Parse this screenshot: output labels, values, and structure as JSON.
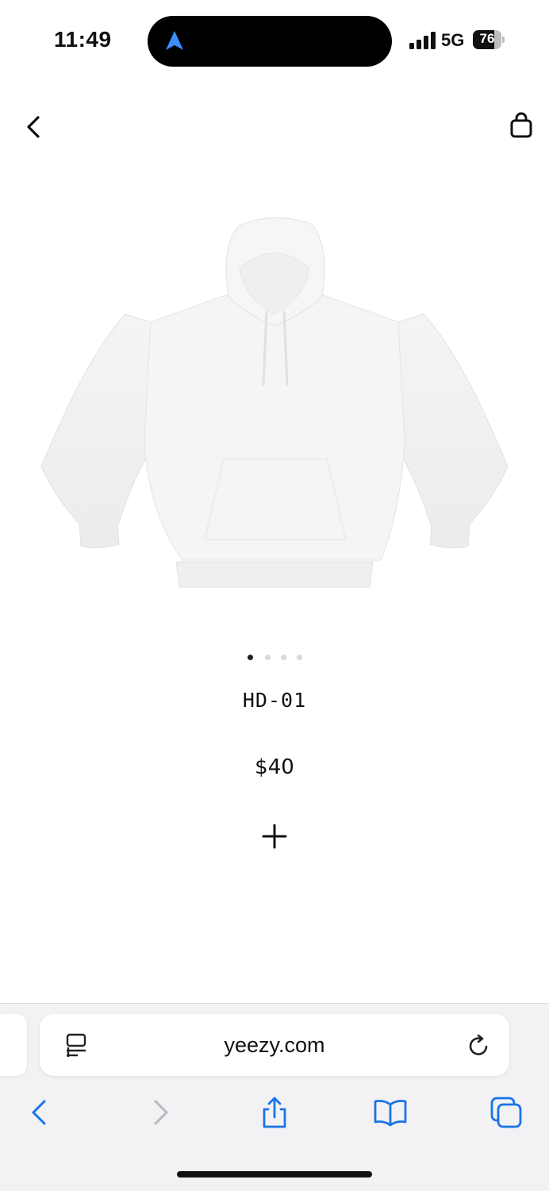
{
  "status_bar": {
    "time": "11:49",
    "network": "5G",
    "battery": "76",
    "battery_level": 0.76,
    "nav_icon": "navigation-arrow-icon"
  },
  "header": {
    "back_icon": "chevron-left-icon",
    "bag_icon": "shopping-bag-icon"
  },
  "product": {
    "image": "white-hoodie-photo",
    "carousel_count": 4,
    "carousel_active": 1,
    "name": "HD-01",
    "price": "$40",
    "add_icon": "plus-icon"
  },
  "browser": {
    "url": "yeezy.com",
    "reader_icon": "reader-mode-icon",
    "reload_icon": "reload-icon",
    "toolbar": [
      "back-icon",
      "forward-icon",
      "share-icon",
      "bookmarks-icon",
      "tabs-icon"
    ],
    "accent_color": "#1a73e8"
  }
}
